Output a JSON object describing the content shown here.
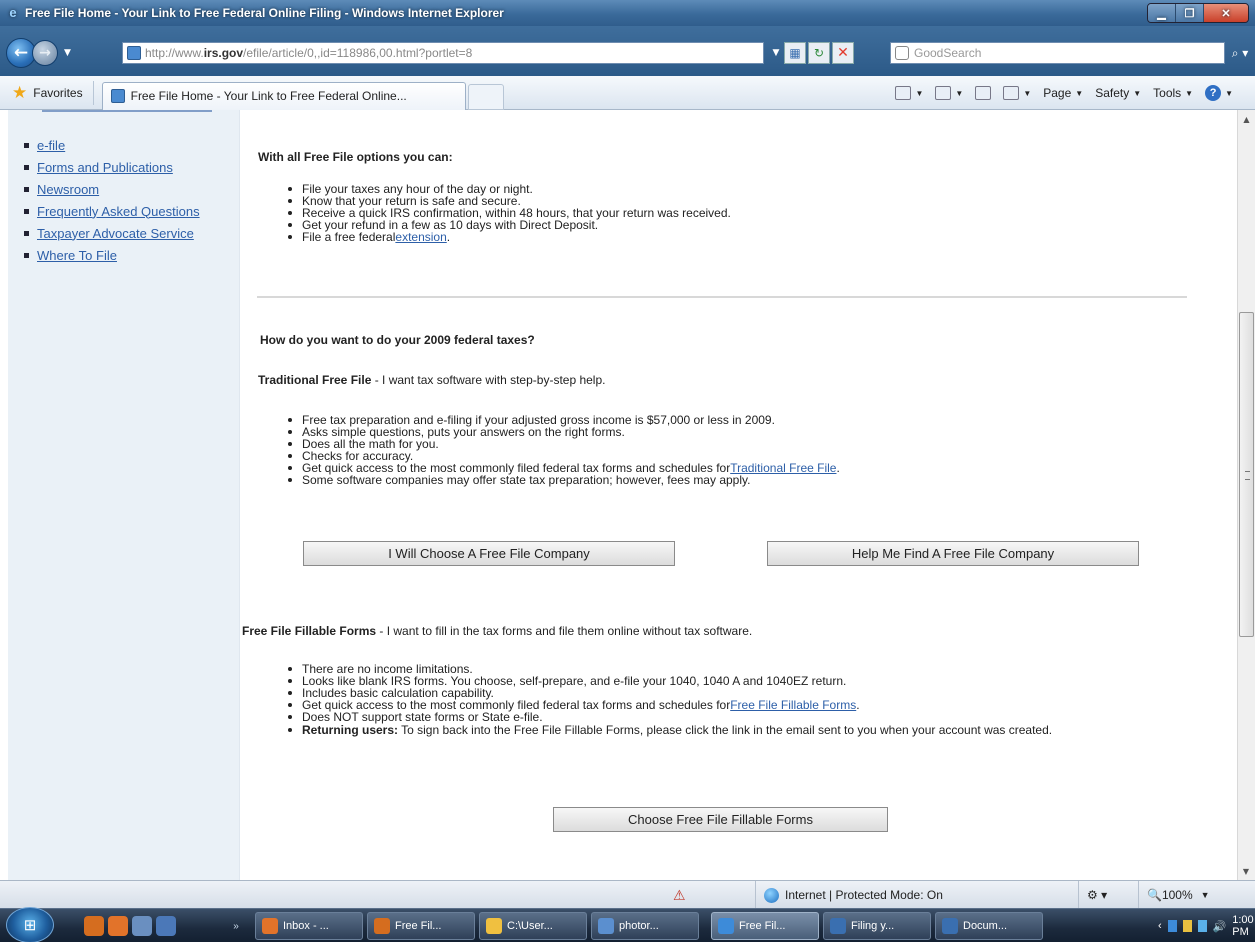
{
  "window": {
    "title": "Free File Home - Your Link to Free Federal Online Filing - Windows Internet Explorer"
  },
  "address_bar": {
    "url_prefix": "http://www.",
    "url_domain": "irs.gov",
    "url_path": "/efile/article/0,,id=118986,00.html?portlet=8",
    "search_placeholder": "GoodSearch"
  },
  "favorites_bar": {
    "favorites_label": "Favorites",
    "tab_title": "Free File Home - Your Link to Free Federal Online..."
  },
  "command_bar": {
    "page_label": "Page",
    "safety_label": "Safety",
    "tools_label": "Tools"
  },
  "sidebar": {
    "items": [
      {
        "label": "e-file"
      },
      {
        "label": "Forms and Publications"
      },
      {
        "label": "Newsroom"
      },
      {
        "label": "Frequently Asked Questions"
      },
      {
        "label": "Taxpayer Advocate Service"
      },
      {
        "label": "Where To File"
      }
    ]
  },
  "main": {
    "options_heading": "With all Free File options you can:",
    "options_items": [
      "File your taxes any hour of the day or night.",
      "Know that your return is safe and secure.",
      "Receive a quick IRS confirmation, within 48 hours, that your return was received.",
      "Get your refund in a few as 10 days with Direct Deposit."
    ],
    "extension_prefix": "File a free federal ",
    "extension_link": "extension",
    "extension_suffix": ".",
    "question": "How do you want to do your 2009 federal taxes?",
    "traditional": {
      "title": "Traditional Free File",
      "desc": " - I want tax software with step-by-step help.",
      "items": [
        "Free tax preparation and e-filing if your adjusted gross income is $57,000 or less in 2009.",
        "Asks simple questions, puts your answers on the right forms.",
        "Does all the math for you.",
        "Checks for accuracy."
      ],
      "access_prefix": "Get quick access to the most commonly filed federal tax forms and schedules for ",
      "access_link": "Traditional Free File",
      "access_suffix": ".",
      "state_note": "Some software companies may offer state tax preparation; however, fees may apply.",
      "choose_button": "I Will Choose A Free File Company",
      "help_button": "Help Me Find A Free File Company"
    },
    "fillable": {
      "title": "Free File Fillable Forms",
      "desc": " - I want to fill in the tax forms and file them online without tax software.",
      "items": [
        "There are no income limitations.",
        "Looks like blank IRS forms. You choose, self-prepare, and e-file your 1040, 1040 A and 1040EZ return.",
        "Includes basic calculation capability."
      ],
      "access_prefix": "Get quick access to the most commonly filed federal tax forms and schedules for ",
      "access_link": "Free File Fillable Forms",
      "access_suffix": ".",
      "state_item": "Does NOT support state forms or State e-file.",
      "returning_label": "Returning users:",
      "returning_text": " To sign back into the Free File Fillable Forms, please click the link in the email sent to you when your account was created.",
      "choose_button": "Choose Free File Fillable Forms"
    }
  },
  "status_bar": {
    "zone": "Internet | Protected Mode: On",
    "zoom": "100%"
  },
  "taskbar": {
    "buttons": [
      "Inbox - ...",
      "Free Fil...",
      "C:\\User...",
      "photor...",
      "Free Fil...",
      "Filing y...",
      "Docum..."
    ],
    "clock": "1:00 PM"
  }
}
